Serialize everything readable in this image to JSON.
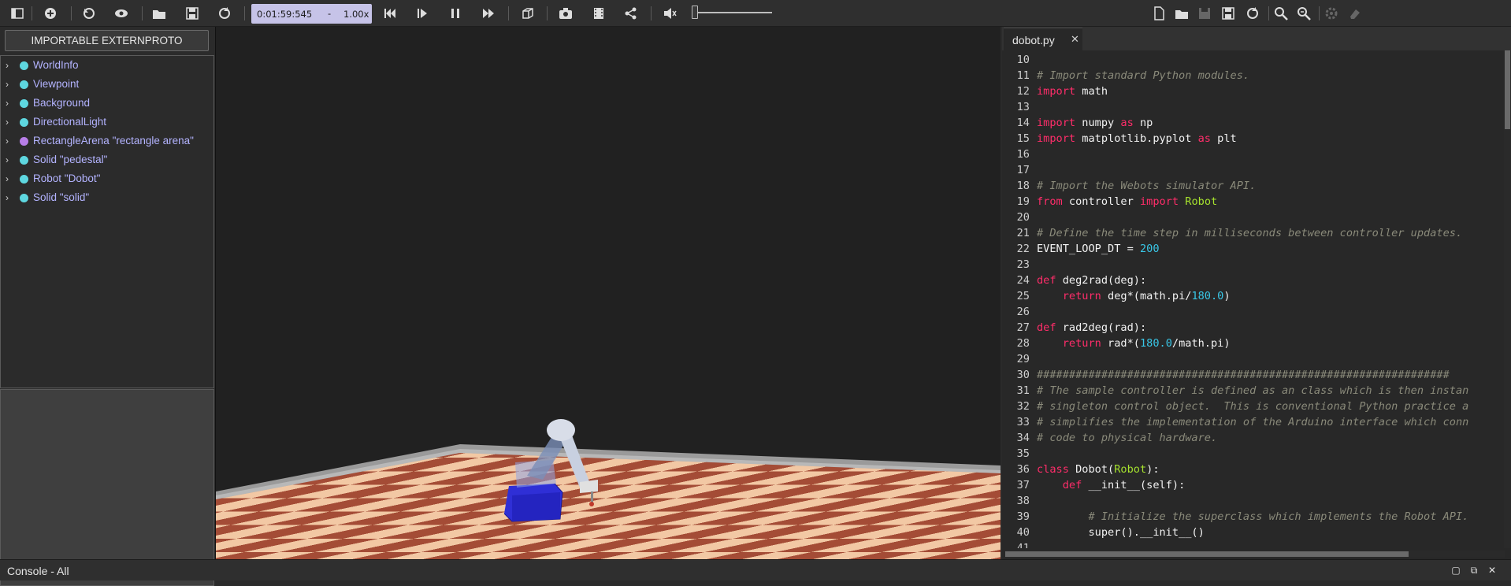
{
  "toolbar": {
    "icons": [
      "hide-scene-tree-icon",
      "add-node-icon",
      "reset-simulation-icon",
      "show-view-icon",
      "open-world-icon",
      "save-world-icon",
      "reload-world-icon",
      "step-backward-icon",
      "step-icon",
      "pause-icon",
      "fast-forward-icon",
      "toggle-3d-icon",
      "screenshot-icon",
      "record-movie-icon",
      "share-icon",
      "mute-icon"
    ],
    "simulation_time": "0:01:59:545",
    "time_separator": "-",
    "speed": "1.00x",
    "editor_icons": [
      "new-file-icon",
      "open-file-icon",
      "save-file-icon",
      "save-as-icon",
      "revert-icon",
      "find-icon",
      "replace-icon",
      "settings-icon",
      "clear-icon"
    ]
  },
  "scene_tree": {
    "extern_button": "IMPORTABLE EXTERNPROTO",
    "items": [
      {
        "label": "WorldInfo",
        "dot_color": "#5ed7e0"
      },
      {
        "label": "Viewpoint",
        "dot_color": "#5ed7e0"
      },
      {
        "label": "Background",
        "dot_color": "#5ed7e0"
      },
      {
        "label": "DirectionalLight",
        "dot_color": "#5ed7e0"
      },
      {
        "label": "RectangleArena \"rectangle arena\"",
        "dot_color": "#b87ee8"
      },
      {
        "label": "Solid \"pedestal\"",
        "dot_color": "#5ed7e0"
      },
      {
        "label": "Robot \"Dobot\"",
        "dot_color": "#5ed7e0"
      },
      {
        "label": "Solid \"solid\"",
        "dot_color": "#5ed7e0"
      }
    ]
  },
  "editor": {
    "tab_label": "dobot.py",
    "tab_close": "✕",
    "lines": [
      {
        "n": "10",
        "html": ""
      },
      {
        "n": "11",
        "html": "<span class=\"cm\"># Import standard Python modules.</span>"
      },
      {
        "n": "12",
        "html": "<span class=\"kw\">import</span> math"
      },
      {
        "n": "13",
        "html": ""
      },
      {
        "n": "14",
        "html": "<span class=\"kw\">import</span> numpy <span class=\"kw\">as</span> np"
      },
      {
        "n": "15",
        "html": "<span class=\"kw\">import</span> matplotlib.pyplot <span class=\"kw\">as</span> plt"
      },
      {
        "n": "16",
        "html": ""
      },
      {
        "n": "17",
        "html": ""
      },
      {
        "n": "18",
        "html": "<span class=\"cm\"># Import the Webots simulator API.</span>"
      },
      {
        "n": "19",
        "html": "<span class=\"kw\">from</span> controller <span class=\"kw\">import</span> <span class=\"cls\">Robot</span>"
      },
      {
        "n": "20",
        "html": ""
      },
      {
        "n": "21",
        "html": "<span class=\"cm\"># Define the time step in milliseconds between controller updates.</span>"
      },
      {
        "n": "22",
        "html": "EVENT_LOOP_DT = <span class=\"num\">200</span>"
      },
      {
        "n": "23",
        "html": ""
      },
      {
        "n": "24",
        "html": "<span class=\"kw\">def</span> deg2rad(deg):"
      },
      {
        "n": "25",
        "html": "    <span class=\"kw\">return</span> deg*(math.pi/<span class=\"num\">180.0</span>)"
      },
      {
        "n": "26",
        "html": ""
      },
      {
        "n": "27",
        "html": "<span class=\"kw\">def</span> rad2deg(rad):"
      },
      {
        "n": "28",
        "html": "    <span class=\"kw\">return</span> rad*(<span class=\"num\">180.0</span>/math.pi)"
      },
      {
        "n": "29",
        "html": ""
      },
      {
        "n": "30",
        "html": "<span class=\"cm\">################################################################</span>"
      },
      {
        "n": "31",
        "html": "<span class=\"cm\"># The sample controller is defined as an class which is then instan</span>"
      },
      {
        "n": "32",
        "html": "<span class=\"cm\"># singleton control object.  This is conventional Python practice a</span>"
      },
      {
        "n": "33",
        "html": "<span class=\"cm\"># simplifies the implementation of the Arduino interface which conn</span>"
      },
      {
        "n": "34",
        "html": "<span class=\"cm\"># code to physical hardware.</span>"
      },
      {
        "n": "35",
        "html": ""
      },
      {
        "n": "36",
        "html": "<span class=\"kw\">class</span> Dobot(<span class=\"cls\">Robot</span>):"
      },
      {
        "n": "37",
        "html": "    <span class=\"kw\">def</span> __init__(self):"
      },
      {
        "n": "38",
        "html": ""
      },
      {
        "n": "39",
        "html": "        <span class=\"cm\"># Initialize the superclass which implements the Robot API.</span>"
      },
      {
        "n": "40",
        "html": "        super().__init__()"
      },
      {
        "n": "41",
        "html": ""
      }
    ]
  },
  "console": {
    "title": "Console - All"
  },
  "colors": {
    "accent_time": "#c6c3e8",
    "node_label": "#b3b3ff",
    "keyword": "#ff2d6a",
    "comment": "#8a8a7a",
    "number": "#39c6e6",
    "class_name": "#a6e22e"
  }
}
